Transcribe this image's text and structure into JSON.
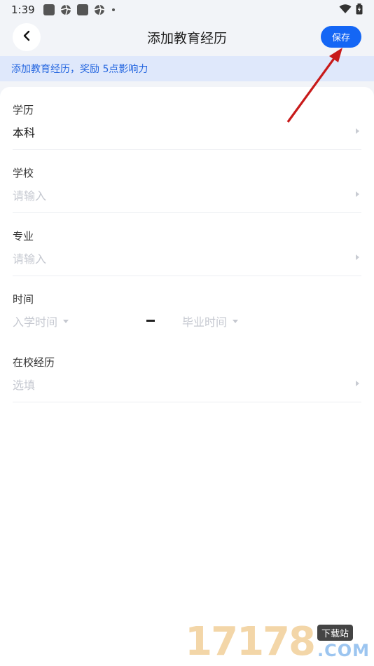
{
  "status_bar": {
    "time": "1:39",
    "left_icons": [
      "square-app-icon",
      "shutter-icon",
      "square-app-icon",
      "shutter-icon",
      "dot-icon"
    ],
    "right_icons": [
      "wifi-icon",
      "battery-icon"
    ]
  },
  "nav": {
    "title": "添加教育经历",
    "save_label": "保存",
    "back_icon": "chevron-left-icon"
  },
  "banner": {
    "text": "添加教育经历，奖励 5点影响力"
  },
  "form": {
    "education": {
      "label": "学历",
      "value": "本科"
    },
    "school": {
      "label": "学校",
      "placeholder": "请输入"
    },
    "major": {
      "label": "专业",
      "placeholder": "请输入"
    },
    "time": {
      "label": "时间",
      "start_placeholder": "入学时间",
      "end_placeholder": "毕业时间",
      "separator": "–"
    },
    "experience": {
      "label": "在校经历",
      "placeholder": "选填"
    }
  },
  "watermark": {
    "digits": "17178",
    "tag": "下载站",
    "domain": ".COM"
  },
  "colors": {
    "accent": "#1466f5",
    "banner_bg": "#dfe8fb",
    "banner_text": "#2667e0",
    "annotation_arrow": "#d81e1e"
  }
}
